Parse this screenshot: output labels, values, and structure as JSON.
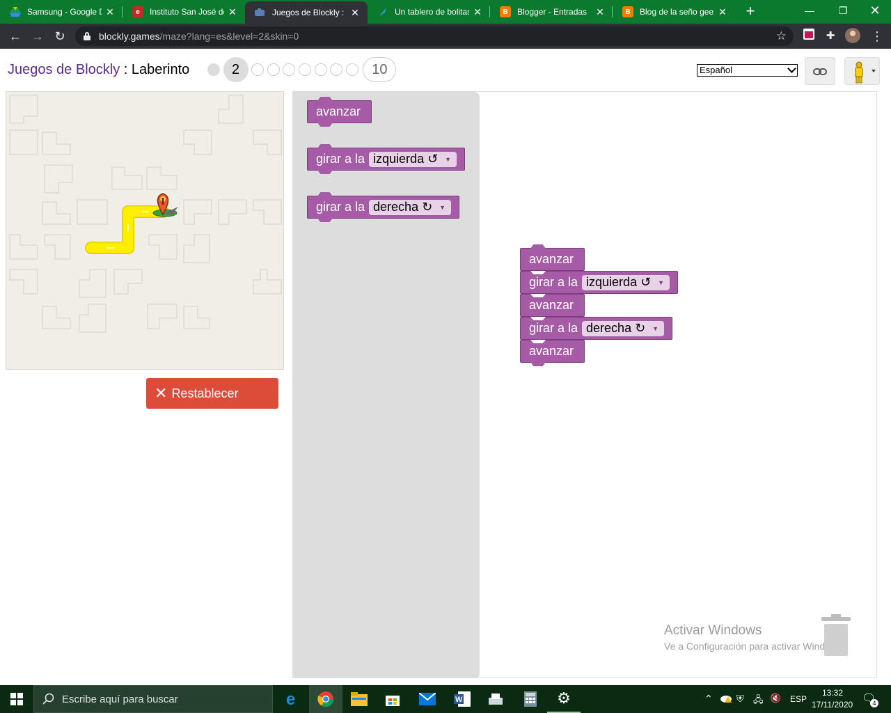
{
  "browser": {
    "tabs": [
      {
        "title": "Samsung - Google D",
        "favicon": "google-drive-icon",
        "color": "#f4b400",
        "active": false
      },
      {
        "title": "Instituto San José de",
        "favicon": "school-icon",
        "color": "#c62828",
        "active": false
      },
      {
        "title": "Juegos de Blockly : La",
        "favicon": "blockly-icon",
        "color": "#4a6fa5",
        "active": true
      },
      {
        "title": "Un tablero de bolitas",
        "favicon": "feather-icon",
        "color": "#1f6fb2",
        "active": false
      },
      {
        "title": "Blogger - Entradas",
        "favicon": "blogger-icon",
        "color": "#f57c00",
        "active": false
      },
      {
        "title": "Blog de la seño geek",
        "favicon": "blogger-icon",
        "color": "#f57c00",
        "active": false
      }
    ],
    "url_host": "blockly.games",
    "url_path": "/maze?lang=es&level=2&skin=0",
    "window_controls": [
      "minimize",
      "restore",
      "close"
    ]
  },
  "page": {
    "brand": "Juegos de Blockly",
    "separator": " : ",
    "game_title": "Laberinto",
    "current_level": "2",
    "last_level": "10",
    "language_selected": "Español",
    "reset_label": "Restablecer"
  },
  "toolbox_blocks": [
    {
      "label": "avanzar"
    },
    {
      "label": "girar a la",
      "option": "izquierda ↺"
    },
    {
      "label": "girar a la",
      "option": "derecha ↻"
    }
  ],
  "program_blocks": [
    {
      "label": "avanzar"
    },
    {
      "label": "girar a la",
      "option": "izquierda ↺"
    },
    {
      "label": "avanzar"
    },
    {
      "label": "girar a la",
      "option": "derecha ↻"
    },
    {
      "label": "avanzar"
    }
  ],
  "watermark": {
    "line1": "Activar Windows",
    "line2": "Ve a Configuración para activar Windows."
  },
  "taskbar": {
    "search_placeholder": "Escribe aquí para buscar",
    "language": "ESP",
    "time": "13:32",
    "date": "17/11/2020",
    "notifications": "4"
  },
  "colors": {
    "chrome_frame": "#0b7a2e",
    "block_purple": "#a55ba5",
    "reset_red": "#dd4b39",
    "brand_purple": "#5b2b8f",
    "maze_path": "#ffee00"
  }
}
